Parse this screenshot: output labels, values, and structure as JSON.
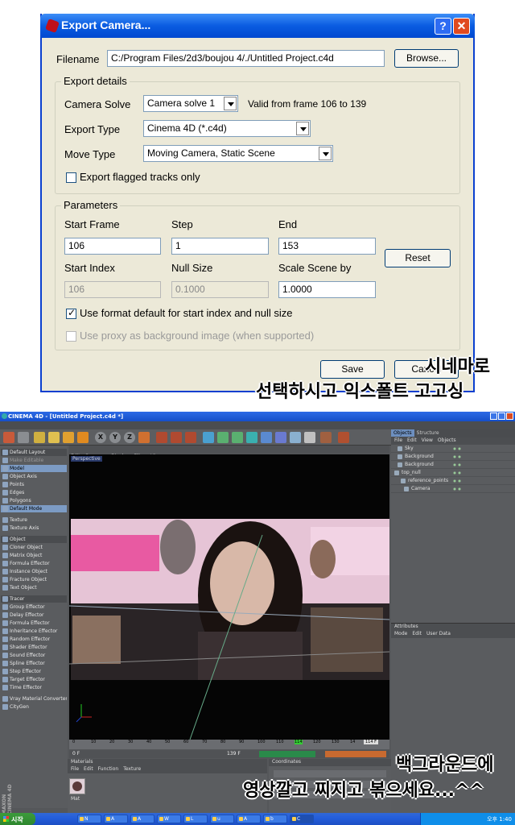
{
  "dialog": {
    "title": "Export Camera...",
    "help_label": "?",
    "close_label": "✕",
    "filename_label": "Filename",
    "filename_value": "C:/Program Files/2d3/boujou 4/./Untitled Project.c4d",
    "browse_label": "Browse...",
    "export_details_legend": "Export details",
    "camera_solve_label": "Camera Solve",
    "camera_solve_value": "Camera solve 1",
    "valid_frames_text": "Valid from frame 106 to 139",
    "export_type_label": "Export Type",
    "export_type_value": "Cinema 4D (*.c4d)",
    "move_type_label": "Move Type",
    "move_type_value": "Moving Camera, Static Scene",
    "export_flagged_label": "Export flagged tracks only",
    "parameters_legend": "Parameters",
    "start_frame_label": "Start Frame",
    "start_frame_value": "106",
    "step_label": "Step",
    "step_value": "1",
    "end_label": "End",
    "end_value": "153",
    "reset_label": "Reset",
    "start_index_label": "Start Index",
    "start_index_value": "106",
    "null_size_label": "Null Size",
    "null_size_value": "0.1000",
    "scale_scene_label": "Scale Scene by",
    "scale_scene_value": "1.0000",
    "use_format_default_label": "Use format default for start index and null size",
    "use_proxy_label": "Use proxy as background image (when supported)",
    "save_label": "Save",
    "cancel_label": "Cancel"
  },
  "captions": {
    "top_line1": "시네마로",
    "top_line2": "선택하시고 익스폴트 고고싱",
    "bottom_line1": "백그라운드에",
    "bottom_line2": "영상깔고 찌지고 볶으세요...^^"
  },
  "c4d": {
    "title": "CINEMA 4D - [Untitled Project.c4d *]",
    "menu": [
      "File",
      "Edit",
      "Objects",
      "Tools",
      "Selection",
      "Structure",
      "Functions",
      "Animation",
      "Character",
      "Dynamics",
      "MoGraph",
      "Hair",
      "Render",
      "Plugins",
      "Window",
      "Help"
    ],
    "viewport_menu": [
      "Edit",
      "Cameras",
      "Display",
      "Filter",
      "View"
    ],
    "viewport_label": "Perspective",
    "palette": [
      "Default Layout",
      "Make Editable",
      "Model",
      "Object Axis",
      "Points",
      "Edges",
      "Polygons",
      "Default Mode",
      "Texture",
      "Texture Axis",
      "Object",
      "Cloner Object",
      "Matrix Object",
      "Formula Effector",
      "Instance Object",
      "Fracture Object",
      "Text Object",
      "Tracer",
      "Group Effector",
      "Delay Effector",
      "Formula Effector",
      "Inheritance Effector",
      "Random Effector",
      "Shader Effector",
      "Sound Effector",
      "Spline Effector",
      "Step Effector",
      "Target Effector",
      "Time Effector",
      "Vray Material Converter",
      "CityGen"
    ],
    "right_tabs": [
      "Objects",
      "Structure"
    ],
    "right_menu": [
      "File",
      "Edit",
      "View",
      "Objects"
    ],
    "objects": [
      "Sky",
      "Background",
      "Background",
      "top_null",
      "reference_points",
      "Camera"
    ],
    "attributes_title": "Attributes",
    "attributes_menu": [
      "Mode",
      "Edit",
      "User Data"
    ],
    "materials_title": "Materials",
    "materials_menu": [
      "File",
      "Edit",
      "Function",
      "Texture"
    ],
    "material_name": "Mat",
    "coordinates_title": "Coordinates",
    "timeline_ticks": [
      "0",
      "10",
      "20",
      "30",
      "40",
      "50",
      "60",
      "70",
      "80",
      "90",
      "100",
      "110",
      "114",
      "120",
      "130",
      "14"
    ],
    "timeline_end": "114 F",
    "transport_start": "0 F",
    "transport_end": "139 F",
    "brand": "MAXON CINEMA 4D"
  },
  "taskbar": {
    "start_label": "시작",
    "items": [
      "N",
      "A",
      "A",
      "W",
      "L",
      "u",
      "A",
      "b",
      "C"
    ],
    "clock": "오후 1:40"
  }
}
